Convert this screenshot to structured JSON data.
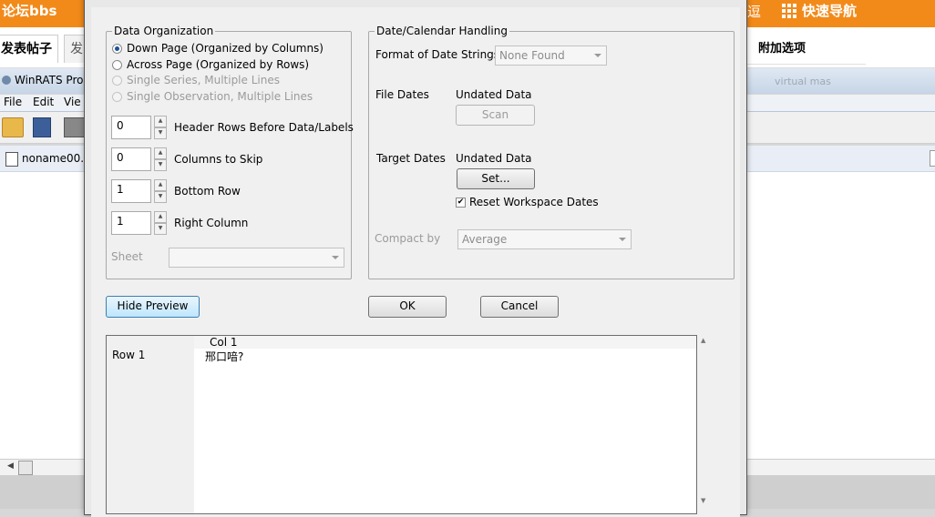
{
  "background": {
    "forum": {
      "brand": "论坛bbs",
      "nav_partial_char": "逗",
      "nav_label": "快速导航",
      "tab_post": "发表帖子",
      "tab_partial": "发",
      "extra_options": "附加选项"
    },
    "winrats": {
      "title": "WinRATS Pro",
      "title_blurred": "virtual mas",
      "menu": [
        "File",
        "Edit",
        "Vie"
      ],
      "document": "noname00."
    }
  },
  "dialog": {
    "data_org": {
      "title": "Data Organization",
      "options": [
        {
          "label": "Down Page (Organized by Columns)",
          "checked": true,
          "enabled": true
        },
        {
          "label": "Across Page (Organized by Rows)",
          "checked": false,
          "enabled": true
        },
        {
          "label": "Single Series, Multiple Lines",
          "checked": false,
          "enabled": false
        },
        {
          "label": "Single Observation, Multiple Lines",
          "checked": false,
          "enabled": false
        }
      ],
      "spinners": [
        {
          "value": "0",
          "label": "Header Rows Before Data/Labels"
        },
        {
          "value": "0",
          "label": "Columns to Skip"
        },
        {
          "value": "1",
          "label": "Bottom Row"
        },
        {
          "value": "1",
          "label": "Right Column"
        }
      ],
      "sheet_label": "Sheet",
      "sheet_value": ""
    },
    "date": {
      "title": "Date/Calendar Handling",
      "format_label": "Format of Date Strings",
      "format_value": "None Found",
      "file_dates_label": "File Dates",
      "file_dates_value": "Undated Data",
      "scan_label": "Scan",
      "target_dates_label": "Target Dates",
      "target_dates_value": "Undated Data",
      "set_label": "Set...",
      "reset_label": "Reset Workspace Dates",
      "reset_checked": true,
      "compact_label": "Compact by",
      "compact_value": "Average"
    },
    "buttons": {
      "hide_preview": "Hide Preview",
      "ok": "OK",
      "cancel": "Cancel"
    },
    "preview": {
      "column_header": "Col 1",
      "row_label": "Row 1",
      "cell_value": "邢口喑?"
    }
  }
}
